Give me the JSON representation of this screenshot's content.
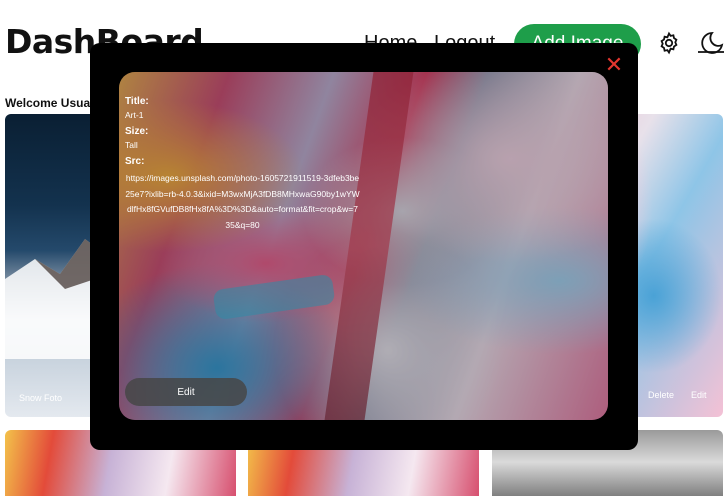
{
  "header": {
    "brand": "DashBoard",
    "nav": {
      "home": "Home",
      "logout": "Logout"
    },
    "add_button": "Add Image",
    "settings_icon": "gear-icon",
    "theme_icon": "moon-icon"
  },
  "welcome_text": "Welcome Usua",
  "gallery": {
    "cards": [
      {
        "label": "Snow Foto"
      },
      {
        "delete_label": "Delete",
        "edit_label": "Edit"
      }
    ]
  },
  "modal": {
    "title_label": "Title:",
    "title_value": "Art-1",
    "size_label": "Size:",
    "size_value": "Tall",
    "src_label": "Src:",
    "src_value": "https://images.unsplash.com/photo-1605721911519-3dfeb3be25e7?ixlib=rb-4.0.3&ixid=M3wxMjA3fDB8MHxwaG90by1wYWdlfHx8fGVufDB8fHx8fA%3D%3D&auto=format&fit=crop&w=735&q=80",
    "edit_button": "Edit",
    "close_icon": "close-icon"
  },
  "colors": {
    "accent": "#1e9e4a",
    "close": "#e2362f",
    "modal_bg": "#000000"
  }
}
